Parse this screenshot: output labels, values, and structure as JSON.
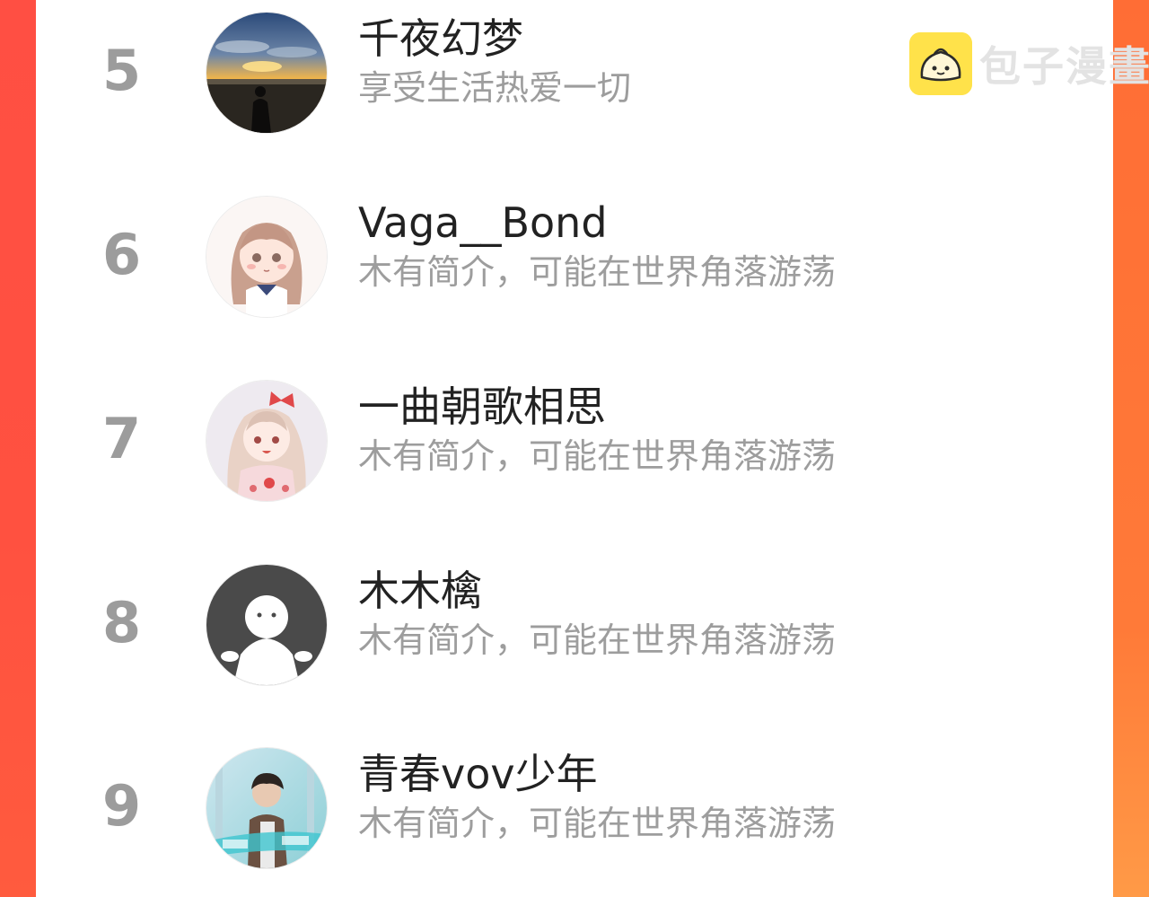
{
  "watermark": {
    "icon": "bun-logo-icon",
    "text": "包子漫畫",
    "color": "#ffe24a"
  },
  "ranking": [
    {
      "rank": "5",
      "name": "千夜幻梦",
      "bio": "享受生活热爱一切",
      "avatar": "sunset-silhouette-avatar"
    },
    {
      "rank": "6",
      "name": "Vaga__Bond",
      "bio": "木有简介，可能在世界角落游荡",
      "avatar": "anime-girl-avatar"
    },
    {
      "rank": "7",
      "name": "一曲朝歌相思",
      "bio": "木有简介，可能在世界角落游荡",
      "avatar": "anime-girl-kimono-avatar"
    },
    {
      "rank": "8",
      "name": "木木檎",
      "bio": "木有简介，可能在世界角落游荡",
      "avatar": "default-user-avatar"
    },
    {
      "rank": "9",
      "name": "青春vov少年",
      "bio": "木有简介，可能在世界角落游荡",
      "avatar": "photo-boy-avatar"
    }
  ],
  "colors": {
    "accent_left": "#ff4f43",
    "accent_right": "#ff7a38",
    "rank_text": "#9c9c9c",
    "bio_text": "#9d9d9d"
  }
}
